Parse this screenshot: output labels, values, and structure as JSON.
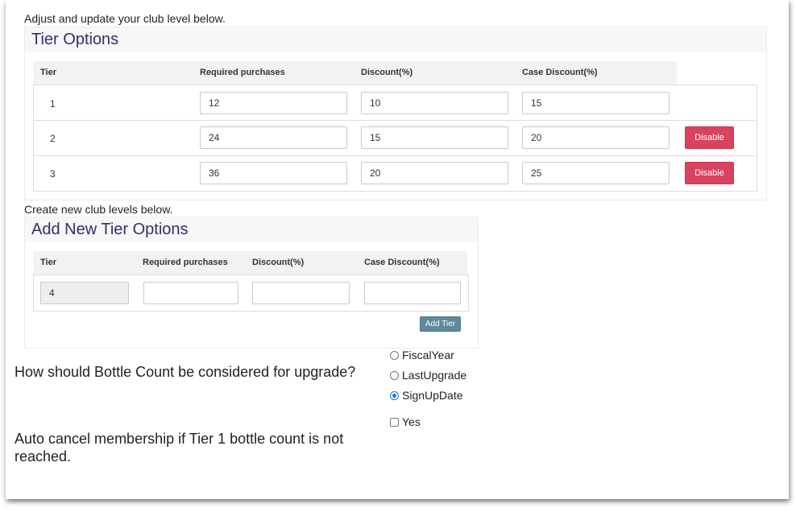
{
  "intro_text": "Adjust and update your club level below.",
  "tier_options": {
    "title": "Tier Options",
    "headers": [
      "Tier",
      "Required purchases",
      "Discount(%)",
      "Case Discount(%)"
    ],
    "rows": [
      {
        "tier": "1",
        "required": "12",
        "discount": "10",
        "case_discount": "15",
        "action": ""
      },
      {
        "tier": "2",
        "required": "24",
        "discount": "15",
        "case_discount": "20",
        "action": "Disable"
      },
      {
        "tier": "3",
        "required": "36",
        "discount": "20",
        "case_discount": "25",
        "action": "Disable"
      }
    ]
  },
  "create_text": "Create new club levels below.",
  "add_tier": {
    "title": "Add New Tier Options",
    "headers": [
      "Tier",
      "Required purchases",
      "Discount(%)",
      "Case Discount(%)"
    ],
    "tier_value": "4",
    "required_value": "",
    "discount_value": "",
    "case_discount_value": "",
    "button_label": "Add Tier"
  },
  "bottle_count": {
    "question": "How should Bottle Count be considered for upgrade?",
    "options": [
      "FiscalYear",
      "LastUpgrade",
      "SignUpDate"
    ],
    "selected": "SignUpDate"
  },
  "auto_cancel": {
    "question": "Auto cancel membership if Tier 1 bottle count is not reached.",
    "checkbox_label": "Yes",
    "checked": false
  },
  "colors": {
    "heading": "#3c2a6b",
    "disable_button": "#d9435f",
    "add_button": "#5f8a9c",
    "radio_selected": "#1a73e8"
  }
}
